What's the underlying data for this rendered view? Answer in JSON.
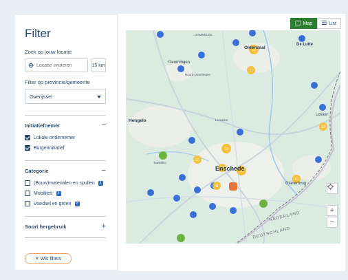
{
  "filter": {
    "title": "Filter",
    "location_label": "Zoek op jouw locatie",
    "location_placeholder": "Locatie invoeren",
    "radius": "15 km",
    "province_label": "Filter op provincie/gemeente",
    "province_value": "Overijssel"
  },
  "sections": {
    "initiatiefnemer": {
      "title": "Initiatiefnemer",
      "toggle": "−",
      "options": [
        {
          "label": "Lokale ondernemer",
          "checked": true
        },
        {
          "label": "Burgerinitiatief",
          "checked": true
        }
      ]
    },
    "categorie": {
      "title": "Categorie",
      "toggle": "−",
      "options": [
        {
          "label": "(Bouw)materialen en spullen",
          "checked": false
        },
        {
          "label": "Mobiliteit",
          "checked": false
        },
        {
          "label": "Voedsel en groen",
          "checked": false
        }
      ]
    },
    "hergebruik": {
      "title": "Soort hergebruik",
      "toggle": "+"
    }
  },
  "clear_filters": "✕ Wis filters",
  "view_toggle": {
    "map": "Map",
    "list": "List"
  },
  "map": {
    "places": [
      "Hengelo",
      "Enschede",
      "Deurningen",
      "Oldenzaal",
      "De Lutte",
      "Losser",
      "Glanerbrug",
      "NEDERLAND",
      "DEUTSCHLAND",
      "GAMMELKE",
      "Twekkelo",
      "Noord-Deurningen",
      "Lonneker"
    ],
    "colors": {
      "blue": "#3b6fd8",
      "yellow": "#f2c13d",
      "orange": "#e8743b",
      "green": "#6db33f"
    },
    "zoom_in": "+",
    "zoom_out": "−"
  }
}
